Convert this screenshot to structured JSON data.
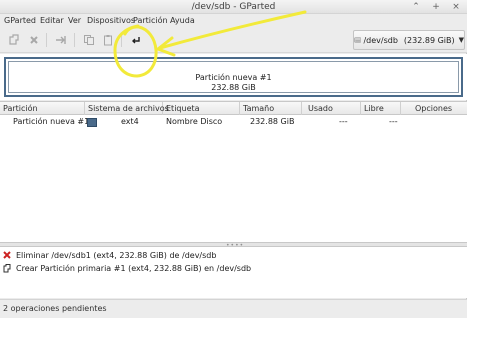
{
  "window": {
    "title": "/dev/sdb - GParted",
    "controls": [
      "⌃",
      "+",
      "×"
    ]
  },
  "menubar": {
    "items": [
      "GParted",
      "Editar",
      "Ver",
      "Dispositivos",
      "Partición",
      "Ayuda"
    ]
  },
  "toolbar": {
    "buttons": [
      "new-partition-icon",
      "delete-icon",
      "resize-move-icon",
      "copy-icon",
      "paste-icon",
      "undo-icon",
      "apply-icon"
    ],
    "device": {
      "name": "/dev/sdb",
      "size": "(232.89 GiB)"
    }
  },
  "graph": {
    "partition_name": "Partición nueva #1",
    "partition_size": "232.88 GiB"
  },
  "table": {
    "columns": [
      "Partición",
      "Sistema de archivos",
      "Etiqueta",
      "Tamaño",
      "Usado",
      "Libre",
      "Opciones"
    ],
    "rows": [
      {
        "particion": "Partición nueva #1",
        "sistema": "ext4",
        "etiqueta": "Nombre Disco",
        "tamano": "232.88 GiB",
        "usado": "---",
        "libre": "---",
        "opciones": ""
      }
    ]
  },
  "operations": [
    {
      "icon": "delete-icon",
      "text": "Eliminar /dev/sdb1 (ext4, 232.88 GiB) de /dev/sdb"
    },
    {
      "icon": "new-partition-icon",
      "text": "Crear Partición primaria #1 (ext4, 232.88 GiB) en /dev/sdb"
    }
  ],
  "status": {
    "text": "2 operaciones pendientes"
  },
  "colors": {
    "ext4": "#4a6a8a",
    "annotation": "#f2ea3a",
    "delete": "#cc2222"
  }
}
